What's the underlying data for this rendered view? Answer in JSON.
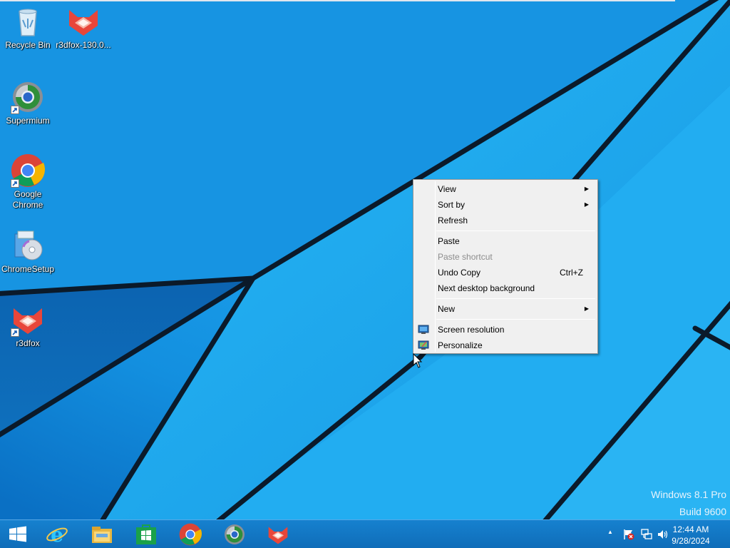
{
  "desktop": {
    "icons": [
      {
        "label": "Recycle Bin",
        "icon": "recycle-bin-icon"
      },
      {
        "label": "r3dfox-130.0...",
        "icon": "r3dfox-icon"
      },
      {
        "label": "Supermium",
        "icon": "supermium-icon"
      },
      {
        "label": "Google Chrome",
        "icon": "chrome-icon"
      },
      {
        "label": "ChromeSetup",
        "icon": "setup-icon"
      },
      {
        "label": "r3dfox",
        "icon": "r3dfox-icon"
      }
    ],
    "watermark": {
      "line1": "Windows 8.1 Pro",
      "line2": "Build 9600"
    }
  },
  "context_menu": {
    "items": [
      {
        "label": "View",
        "submenu": true
      },
      {
        "label": "Sort by",
        "submenu": true
      },
      {
        "label": "Refresh"
      },
      {
        "label": "Paste"
      },
      {
        "label": "Paste shortcut",
        "disabled": true
      },
      {
        "label": "Undo Copy",
        "shortcut": "Ctrl+Z"
      },
      {
        "label": "Next desktop background"
      },
      {
        "label": "New",
        "submenu": true
      },
      {
        "label": "Screen resolution",
        "icon": "monitor-icon"
      },
      {
        "label": "Personalize",
        "icon": "personalize-icon"
      }
    ],
    "submenu_arrow": "▶"
  },
  "taskbar": {
    "pinned": [
      "start-button",
      "internet-explorer",
      "file-explorer",
      "windows-store",
      "google-chrome",
      "supermium",
      "r3dfox"
    ],
    "tray": {
      "show_hidden_arrow": "▲",
      "time": "12:44 AM",
      "date": "9/28/2024"
    }
  },
  "colors": {
    "desktop_blue": "#1a9be6",
    "taskbar": "#1476c6",
    "menu_bg": "#f0f0f0"
  }
}
